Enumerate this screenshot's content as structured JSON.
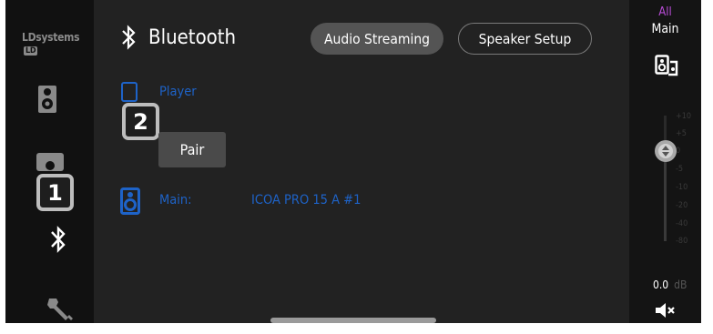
{
  "sidebar": {
    "logo_text": "LDsystems",
    "logo_badge": "LD",
    "items": [
      {
        "icon": "speaker-icon",
        "active": false
      },
      {
        "icon": "speaker-pair-icon",
        "active": false
      },
      {
        "icon": "bluetooth-icon",
        "active": true
      },
      {
        "icon": "wrench-icon",
        "active": false
      }
    ]
  },
  "header": {
    "title": "Bluetooth",
    "tabs": [
      {
        "label": "Audio Streaming",
        "active": true
      },
      {
        "label": "Speaker Setup",
        "active": false
      }
    ]
  },
  "main": {
    "player_label": "Player",
    "pair_button": "Pair",
    "device_label": "Main:",
    "device_name": "ICOA PRO 15 A #1"
  },
  "annotations": {
    "badge_1": "1",
    "badge_2": "2"
  },
  "right_panel": {
    "group": "All",
    "channel": "Main",
    "fader_ticks": [
      "+10",
      "+5",
      "0",
      "-5",
      "-10",
      "-20",
      "-40",
      "-80"
    ],
    "level_value": "0.0",
    "level_unit": "dB",
    "mute_icon": "speaker-mute-icon"
  },
  "colors": {
    "accent_blue": "#1e63c8",
    "accent_purple": "#b84cd6",
    "background": "#222222",
    "sidebar_bg": "#111111"
  }
}
